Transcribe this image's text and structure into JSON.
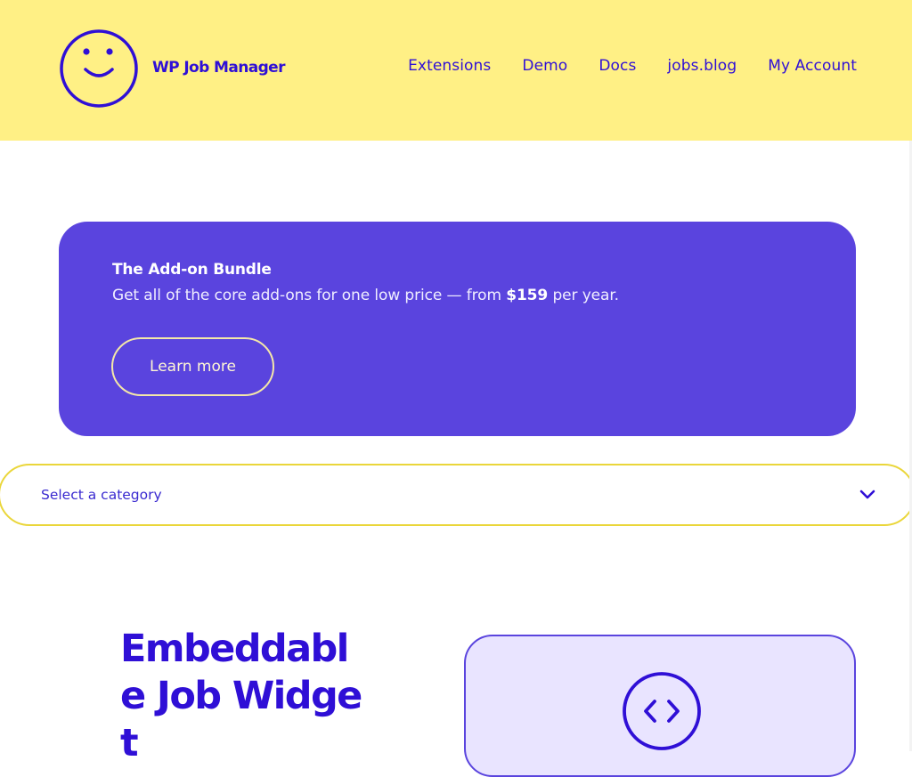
{
  "header": {
    "brand": "WP Job Manager",
    "logo_icon": "smiley-face-icon",
    "nav": [
      {
        "label": "Extensions"
      },
      {
        "label": "Demo"
      },
      {
        "label": "Docs"
      },
      {
        "label": "jobs.blog"
      },
      {
        "label": "My Account"
      }
    ]
  },
  "banner": {
    "title": "The Add-on Bundle",
    "desc_prefix": "Get all of the core add-ons for one low price — from ",
    "price": "$159",
    "desc_suffix": " per year.",
    "button_label": "Learn more"
  },
  "category_select": {
    "value": "Select a category",
    "icon": "chevron-down-icon"
  },
  "hero": {
    "title": "Embeddable Job Widget",
    "card_icon": "code-icon"
  },
  "colors": {
    "header_bg": "#fff085",
    "brand_blue": "#2f0fd6",
    "banner_purple": "#5a44de",
    "card_bg": "#e9e4ff",
    "select_border": "#ead63a"
  }
}
